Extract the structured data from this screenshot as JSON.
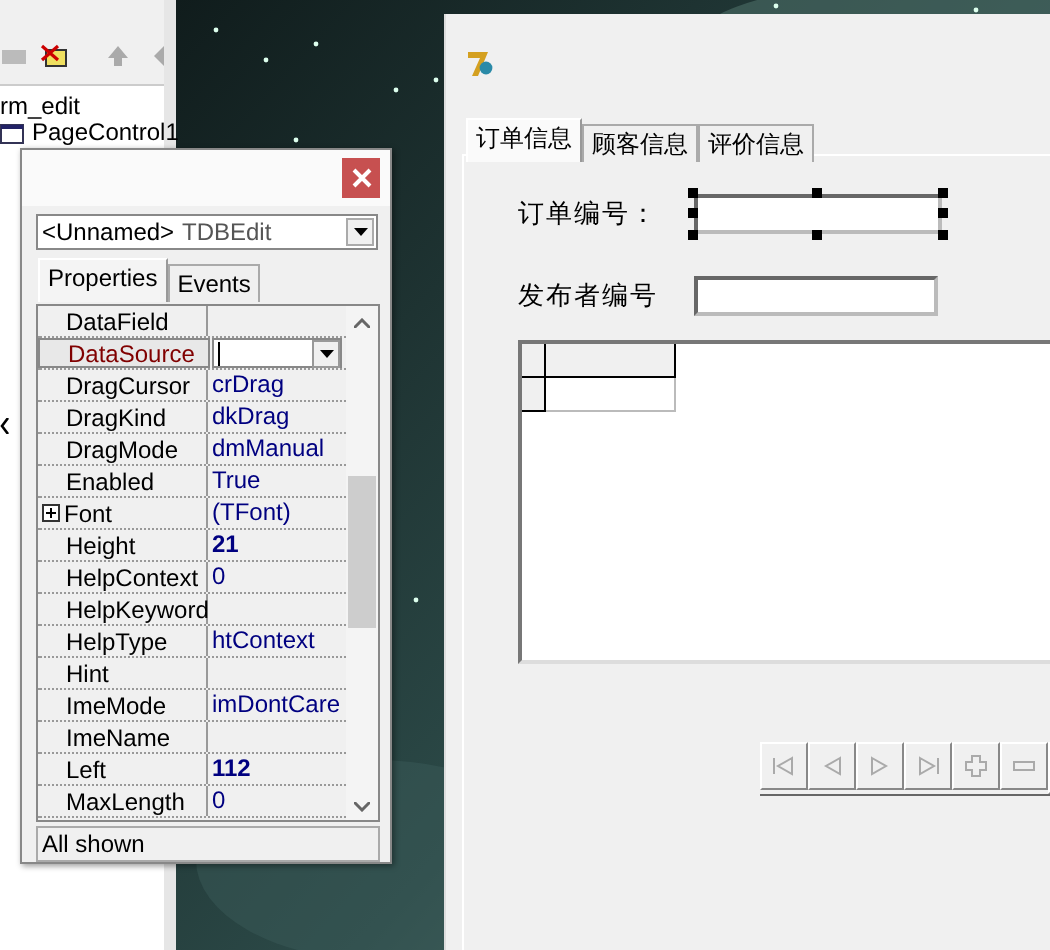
{
  "object_tree": {
    "items": [
      {
        "label": "rm_edit"
      },
      {
        "label": "PageControl1"
      }
    ]
  },
  "form": {
    "tabs": [
      {
        "label": "订单信息",
        "selected": true
      },
      {
        "label": "顾客信息",
        "selected": false
      },
      {
        "label": "评价信息",
        "selected": false
      }
    ],
    "fields": [
      {
        "label": "订单编号：",
        "selected": true
      },
      {
        "label": "发布者编号",
        "selected": false
      }
    ]
  },
  "inspector": {
    "object_name": "<Unnamed>",
    "object_type": "TDBEdit",
    "tabs": [
      {
        "label": "Properties",
        "selected": true
      },
      {
        "label": "Events",
        "selected": false
      }
    ],
    "properties": [
      {
        "name": "DataField",
        "selected": false
      },
      {
        "name": "DataSource",
        "selected": true
      },
      {
        "name": "DragCursor",
        "value": "crDrag",
        "selected": false,
        "bold": false
      },
      {
        "name": "DragKind",
        "value": "dkDrag",
        "selected": false,
        "bold": false
      },
      {
        "name": "DragMode",
        "value": "dmManual",
        "selected": false,
        "bold": false
      },
      {
        "name": "Enabled",
        "value": "True",
        "selected": false,
        "bold": false
      },
      {
        "name": "Font",
        "value": "(TFont)",
        "selected": false,
        "bold": false,
        "expandable": true
      },
      {
        "name": "Height",
        "value": "21",
        "selected": false,
        "bold": true
      },
      {
        "name": "HelpContext",
        "value": "0",
        "selected": false,
        "bold": false
      },
      {
        "name": "HelpKeyword",
        "selected": false
      },
      {
        "name": "HelpType",
        "value": "htContext",
        "selected": false,
        "bold": false
      },
      {
        "name": "Hint",
        "selected": false
      },
      {
        "name": "ImeMode",
        "value": "imDontCare",
        "selected": false,
        "bold": false
      },
      {
        "name": "ImeName",
        "selected": false
      },
      {
        "name": "Left",
        "value": "112",
        "selected": false,
        "bold": true
      },
      {
        "name": "MaxLength",
        "value": "0",
        "selected": false,
        "bold": false
      }
    ],
    "status": "All shown"
  }
}
